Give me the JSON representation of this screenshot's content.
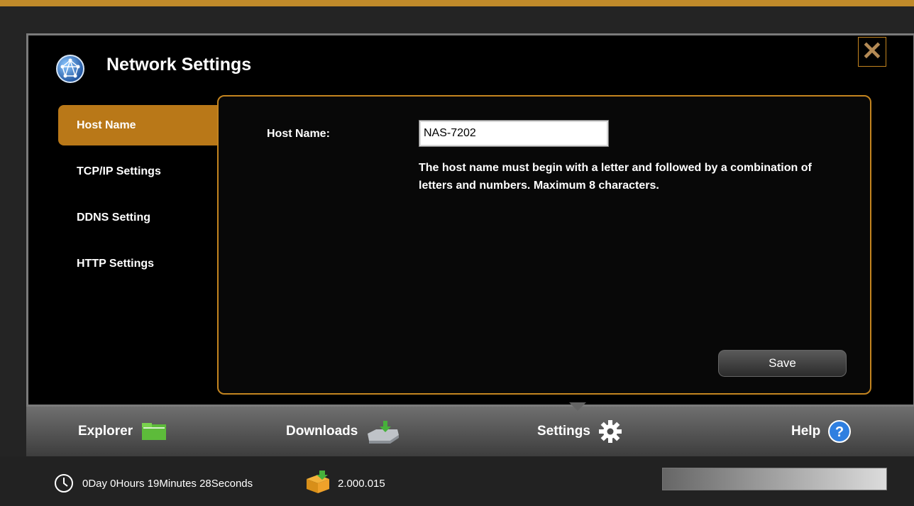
{
  "window": {
    "title": "Network Settings",
    "close_symbol": "✕"
  },
  "sidebar": {
    "items": [
      {
        "label": "Host Name",
        "active": true
      },
      {
        "label": "TCP/IP Settings",
        "active": false
      },
      {
        "label": "DDNS Setting",
        "active": false
      },
      {
        "label": "HTTP Settings",
        "active": false
      }
    ]
  },
  "form": {
    "host_label": "Host Name:",
    "host_value": "NAS-7202",
    "help_text": "The host name must begin with a letter and followed by a combination of letters and numbers. Maximum 8 characters.",
    "save_label": "Save"
  },
  "dock": {
    "items": [
      {
        "label": "Explorer",
        "icon": "folder-icon"
      },
      {
        "label": "Downloads",
        "icon": "download-drive-icon"
      },
      {
        "label": "Settings",
        "icon": "gear-icon"
      },
      {
        "label": "Help",
        "icon": "help-icon"
      }
    ]
  },
  "status": {
    "uptime": "0Day 0Hours 19Minutes 28Seconds",
    "version": "2.000.015"
  },
  "colors": {
    "accent": "#c3841f",
    "active_tab": "#b97818"
  }
}
